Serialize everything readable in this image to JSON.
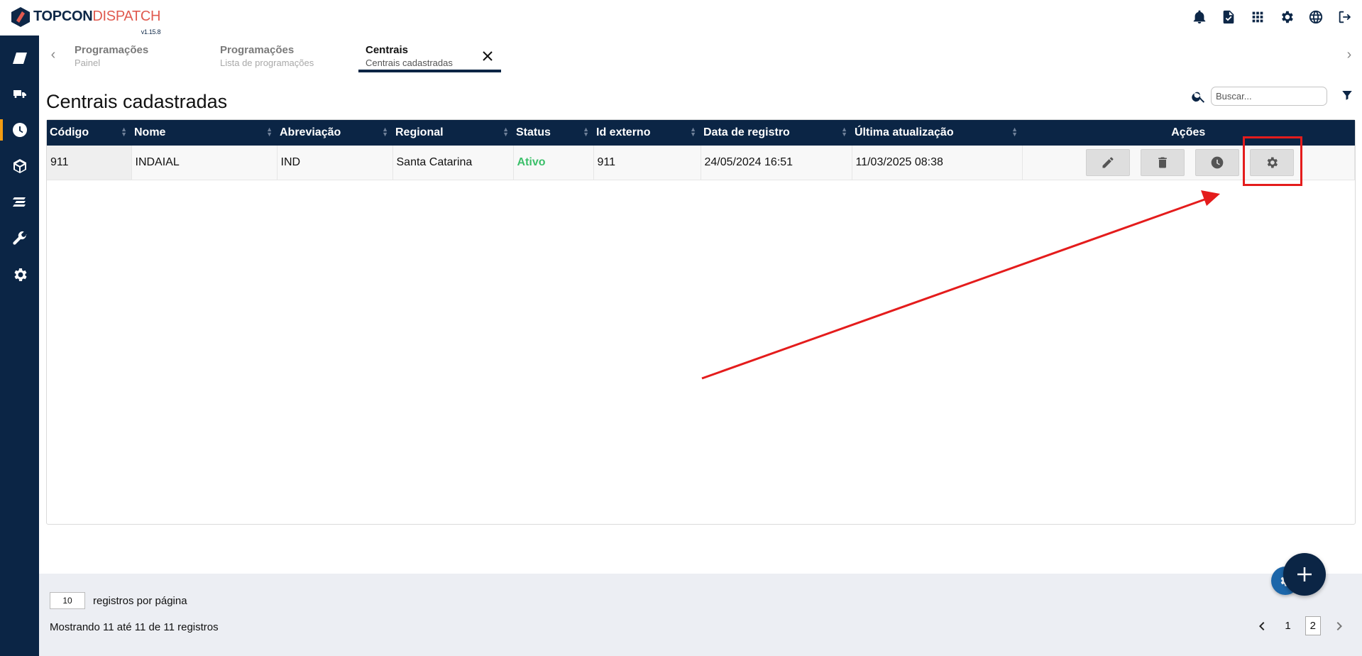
{
  "app": {
    "brand_bold": "TOPCON",
    "brand_light": "DISPATCH",
    "version": "v1.15.8",
    "accent_color": "#0b2545",
    "highlight_color": "#e41c1c"
  },
  "topbar": {
    "icons": [
      "bell-icon",
      "document-check-icon",
      "apps-grid-icon",
      "gear-icon",
      "globe-icon",
      "logout-icon"
    ]
  },
  "sidebar": {
    "items": [
      {
        "icon": "concrete-icon",
        "active": false
      },
      {
        "icon": "truck-icon",
        "active": false
      },
      {
        "icon": "clock-icon",
        "active": true
      },
      {
        "icon": "plant-icon",
        "active": false
      },
      {
        "icon": "layers-icon",
        "active": false
      },
      {
        "icon": "wrench-icon",
        "active": false
      },
      {
        "icon": "settings-icon",
        "active": false
      }
    ]
  },
  "tabs": [
    {
      "title": "Programações",
      "subtitle": "Painel"
    },
    {
      "title": "Programações",
      "subtitle": "Lista de programações"
    },
    {
      "title": "Centrais",
      "subtitle": "Centrais cadastradas",
      "active": true
    }
  ],
  "page": {
    "title": "Centrais cadastradas",
    "search_placeholder": "Buscar..."
  },
  "table": {
    "columns": [
      "Código",
      "Nome",
      "Abreviação",
      "Regional",
      "Status",
      "Id externo",
      "Data de registro",
      "Última atualização",
      "Ações"
    ],
    "rows": [
      {
        "codigo": "911",
        "nome": "INDAIAL",
        "abreviacao": "IND",
        "regional": "Santa Catarina",
        "status": "Ativo",
        "id_externo": "911",
        "data_registro": "24/05/2024 16:51",
        "ultima_atualizacao": "11/03/2025 08:38"
      }
    ],
    "row_actions": [
      "edit-icon",
      "trash-icon",
      "history-icon",
      "settings-icon"
    ]
  },
  "footer": {
    "per_page": "10",
    "per_page_label": "registros por página",
    "showing": "Mostrando 11 até 11 de 11 registros",
    "pages": [
      "1",
      "2"
    ],
    "current_page": "2"
  }
}
